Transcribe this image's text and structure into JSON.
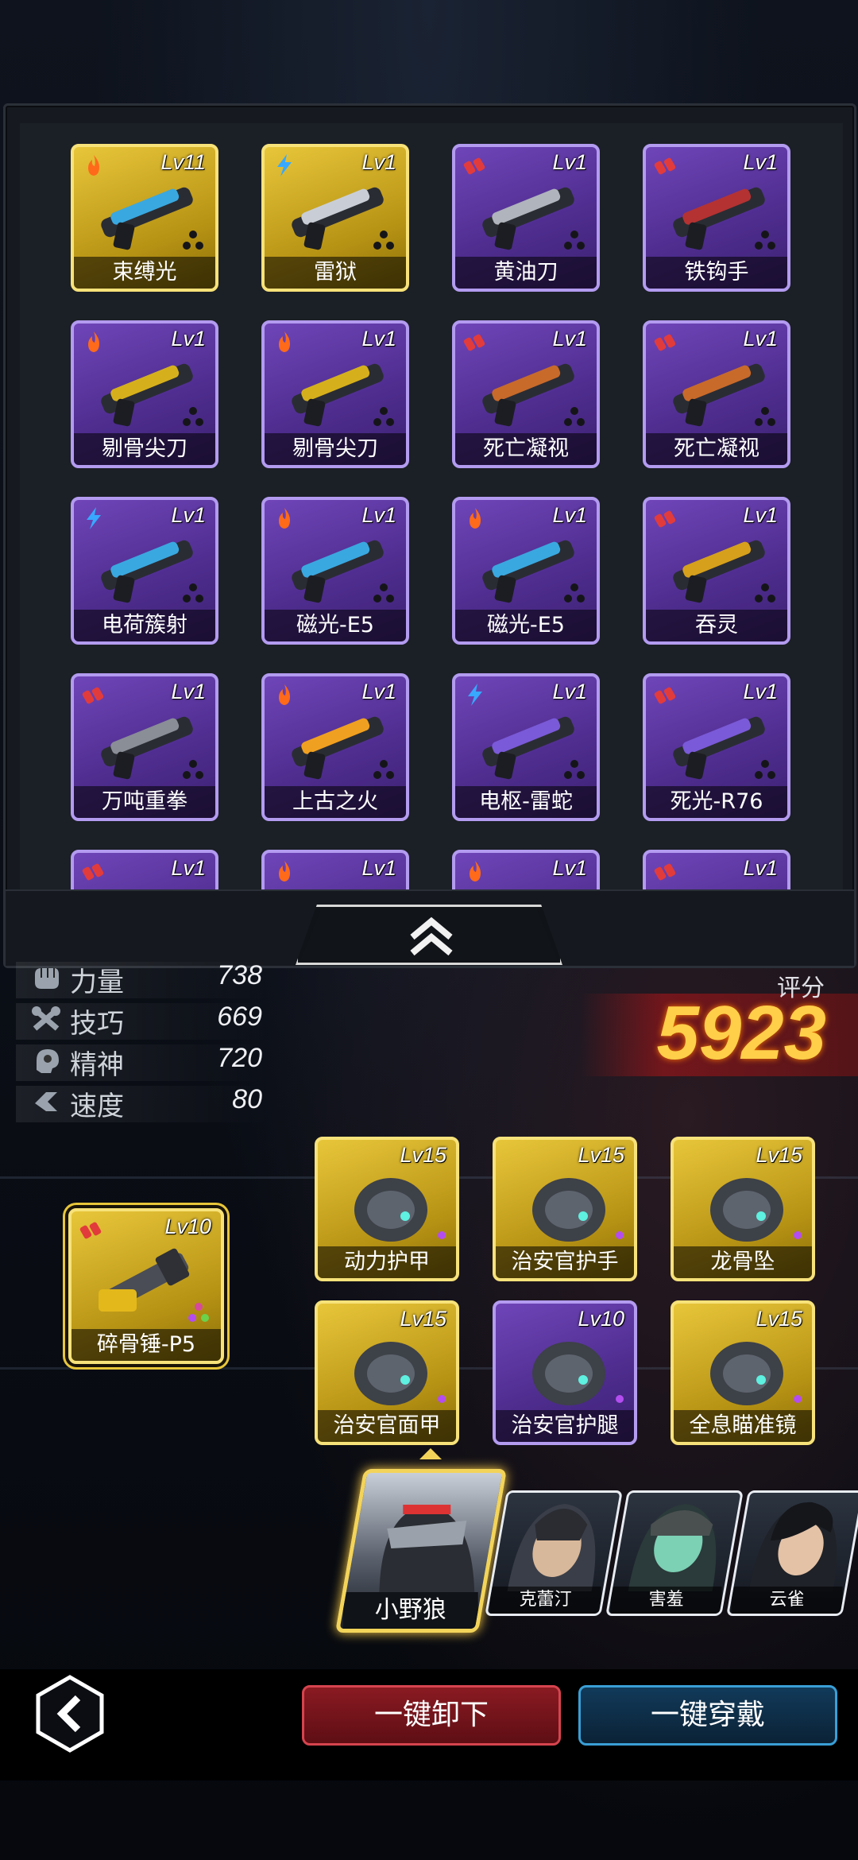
{
  "inventory": {
    "items": [
      {
        "name": "束缚光",
        "level": "Lv11",
        "rarity": "gold",
        "element": "fire-icon"
      },
      {
        "name": "雷狱",
        "level": "Lv1",
        "rarity": "gold",
        "element": "lightning-icon"
      },
      {
        "name": "黄油刀",
        "level": "Lv1",
        "rarity": "purple",
        "element": "ammo-icon"
      },
      {
        "name": "铁钩手",
        "level": "Lv1",
        "rarity": "purple",
        "element": "ammo-icon"
      },
      {
        "name": "剔骨尖刀",
        "level": "Lv1",
        "rarity": "purple",
        "element": "fire-icon"
      },
      {
        "name": "剔骨尖刀",
        "level": "Lv1",
        "rarity": "purple",
        "element": "fire-icon"
      },
      {
        "name": "死亡凝视",
        "level": "Lv1",
        "rarity": "purple",
        "element": "ammo-icon"
      },
      {
        "name": "死亡凝视",
        "level": "Lv1",
        "rarity": "purple",
        "element": "ammo-icon"
      },
      {
        "name": "电荷簇射",
        "level": "Lv1",
        "rarity": "purple",
        "element": "lightning-icon"
      },
      {
        "name": "磁光-E5",
        "level": "Lv1",
        "rarity": "purple",
        "element": "fire-icon"
      },
      {
        "name": "磁光-E5",
        "level": "Lv1",
        "rarity": "purple",
        "element": "fire-icon"
      },
      {
        "name": "吞灵",
        "level": "Lv1",
        "rarity": "purple",
        "element": "ammo-icon"
      },
      {
        "name": "万吨重拳",
        "level": "Lv1",
        "rarity": "purple",
        "element": "ammo-icon"
      },
      {
        "name": "上古之火",
        "level": "Lv1",
        "rarity": "purple",
        "element": "fire-icon"
      },
      {
        "name": "电枢-雷蛇",
        "level": "Lv1",
        "rarity": "purple",
        "element": "lightning-icon"
      },
      {
        "name": "死光-R76",
        "level": "Lv1",
        "rarity": "purple",
        "element": "ammo-icon"
      },
      {
        "name": "",
        "level": "Lv1",
        "rarity": "purple",
        "element": "ammo-icon"
      },
      {
        "name": "",
        "level": "Lv1",
        "rarity": "purple",
        "element": "fire-icon"
      },
      {
        "name": "",
        "level": "Lv1",
        "rarity": "purple",
        "element": "fire-icon"
      },
      {
        "name": "",
        "level": "Lv1",
        "rarity": "purple",
        "element": "ammo-icon"
      }
    ]
  },
  "stats": [
    {
      "label": "力量",
      "value": "738",
      "icon": "fist-icon"
    },
    {
      "label": "技巧",
      "value": "669",
      "icon": "tools-icon"
    },
    {
      "label": "精神",
      "value": "720",
      "icon": "brain-icon"
    },
    {
      "label": "速度",
      "value": "80",
      "icon": "speed-icon"
    }
  ],
  "score": {
    "label": "评分",
    "value": "5923"
  },
  "weapon": {
    "name": "碎骨锤-P5",
    "level": "Lv10"
  },
  "gear": [
    {
      "name": "动力护甲",
      "level": "Lv15",
      "rarity": "gold"
    },
    {
      "name": "治安官护手",
      "level": "Lv15",
      "rarity": "gold"
    },
    {
      "name": "龙骨坠",
      "level": "Lv15",
      "rarity": "gold"
    },
    {
      "name": "治安官面甲",
      "level": "Lv15",
      "rarity": "gold"
    },
    {
      "name": "治安官护腿",
      "level": "Lv10",
      "rarity": "purple"
    },
    {
      "name": "全息瞄准镜",
      "level": "Lv15",
      "rarity": "gold"
    }
  ],
  "heroes": [
    {
      "name": "小野狼",
      "selected": true
    },
    {
      "name": "克蕾汀"
    },
    {
      "name": "害羞"
    },
    {
      "name": "云雀"
    }
  ],
  "buttons": {
    "unequip_all": "一键卸下",
    "equip_all": "一键穿戴"
  },
  "colors": {
    "gold": "#e8c63a",
    "purple": "#6f45b8",
    "score": "#ffcf4a"
  }
}
